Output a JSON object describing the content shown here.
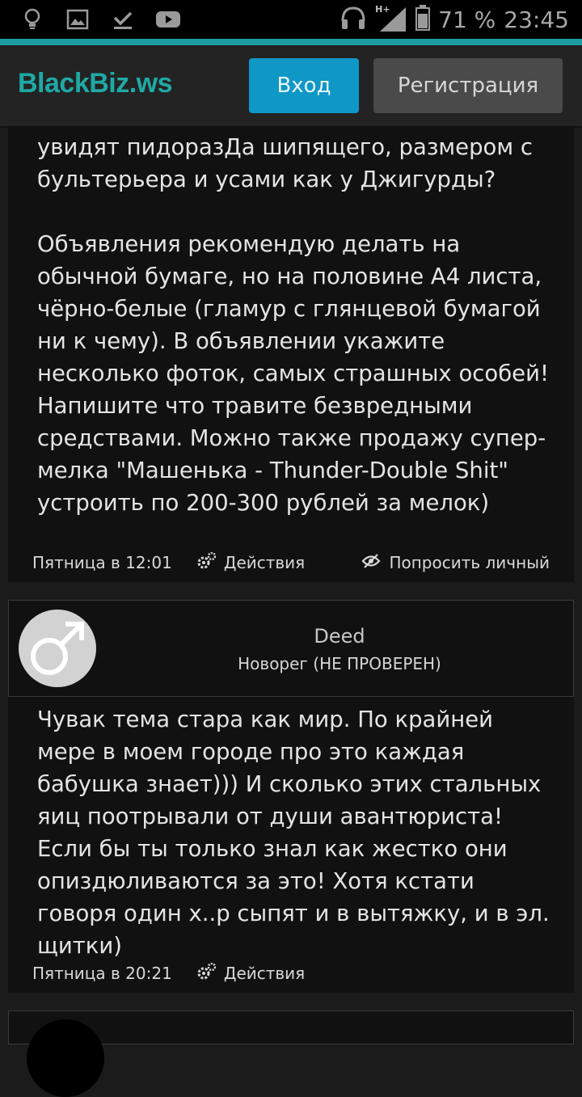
{
  "status_bar": {
    "icons": [
      "lightbulb-icon",
      "image-icon",
      "download-done-icon",
      "youtube-icon"
    ],
    "signal_label": "H+",
    "battery": "71 %",
    "time": "23:45"
  },
  "header": {
    "logo": "BlackBiz.ws",
    "login_label": "Вход",
    "register_label": "Регистрация"
  },
  "posts": [
    {
      "text": "увидят пидоразДа шипящего, размером с бультерьера и усами как у Джигурды?\n\nОбъявления рекомендую делать на обычной бумаге, но на половине А4 листа, чёрно-белые (гламур с глянцевой бумагой ни к чему). В объявлении укажите несколько фоток, самых страшных особей! Напишите что травите безвредными средствами. Можно также продажу супер-мелка \"Машенька - Thunder-Double Shit\" устроить по 200-300 рублей за мелок)",
      "date": "Пятница в 12:01",
      "actions_label": "Действия",
      "report_label": "Попросить личный"
    },
    {
      "author": "Deed",
      "role": "Новорег (НЕ ПРОВЕРЕН)",
      "text": "Чувак тема стара как мир. По крайней мере в моем городе про это каждая бабушка знает))) И сколько этих стальных яиц поотрывали от души авантюриста! Если бы ты только знал как жестко они опиздюливаются за это! Хотя кстати говоря один х..р сыпят и в вытяжку, и в эл. щитки)",
      "date": "Пятница в 20:21",
      "actions_label": "Действия"
    }
  ],
  "colors": {
    "accent": "#1d9ca4",
    "login_button": "#0f97c6",
    "register_button": "#4a4a4a",
    "logo": "#1fa9a6"
  }
}
